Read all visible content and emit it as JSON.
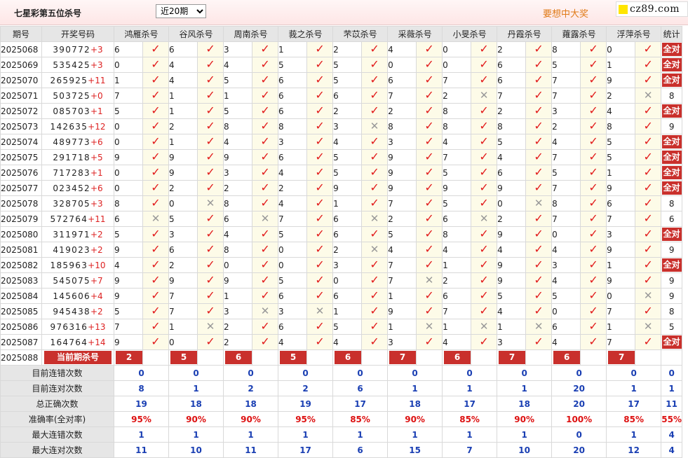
{
  "header": {
    "title": "七星彩第五位杀号",
    "period_selected": "近20期",
    "slogan": "要想中大奖",
    "logo_text": "cz89.com"
  },
  "columns": {
    "issue": "期号",
    "draw": "开奖号码",
    "experts": [
      "鸿雁杀号",
      "谷风杀号",
      "周南杀号",
      "莪之杀号",
      "芣苡杀号",
      "采薇杀号",
      "小旻杀号",
      "丹霞杀号",
      "蕹露杀号",
      "浮萍杀号"
    ],
    "stat": "统计"
  },
  "rows": [
    {
      "issue": "2025068",
      "digits": "390772",
      "plus": "+3",
      "picks": [
        [
          6,
          1
        ],
        [
          6,
          1
        ],
        [
          3,
          1
        ],
        [
          1,
          1
        ],
        [
          2,
          1
        ],
        [
          4,
          1
        ],
        [
          0,
          1
        ],
        [
          2,
          1
        ],
        [
          8,
          1
        ],
        [
          0,
          1
        ]
      ],
      "stat": "全对"
    },
    {
      "issue": "2025069",
      "digits": "535425",
      "plus": "+3",
      "picks": [
        [
          0,
          1
        ],
        [
          4,
          1
        ],
        [
          4,
          1
        ],
        [
          5,
          1
        ],
        [
          5,
          1
        ],
        [
          0,
          1
        ],
        [
          0,
          1
        ],
        [
          6,
          1
        ],
        [
          5,
          1
        ],
        [
          1,
          1
        ]
      ],
      "stat": "全对"
    },
    {
      "issue": "2025070",
      "digits": "265925",
      "plus": "+11",
      "picks": [
        [
          1,
          1
        ],
        [
          4,
          1
        ],
        [
          5,
          1
        ],
        [
          6,
          1
        ],
        [
          5,
          1
        ],
        [
          6,
          1
        ],
        [
          7,
          1
        ],
        [
          6,
          1
        ],
        [
          7,
          1
        ],
        [
          9,
          1
        ]
      ],
      "stat": "全对"
    },
    {
      "issue": "2025071",
      "digits": "503725",
      "plus": "+0",
      "picks": [
        [
          7,
          1
        ],
        [
          1,
          1
        ],
        [
          1,
          1
        ],
        [
          6,
          1
        ],
        [
          6,
          1
        ],
        [
          7,
          1
        ],
        [
          2,
          0
        ],
        [
          7,
          1
        ],
        [
          7,
          1
        ],
        [
          2,
          0
        ]
      ],
      "stat": "8"
    },
    {
      "issue": "2025072",
      "digits": "085703",
      "plus": "+1",
      "picks": [
        [
          5,
          1
        ],
        [
          1,
          1
        ],
        [
          5,
          1
        ],
        [
          6,
          1
        ],
        [
          2,
          1
        ],
        [
          2,
          1
        ],
        [
          8,
          1
        ],
        [
          2,
          1
        ],
        [
          3,
          1
        ],
        [
          4,
          1
        ]
      ],
      "stat": "全对"
    },
    {
      "issue": "2025073",
      "digits": "142635",
      "plus": "+12",
      "picks": [
        [
          0,
          1
        ],
        [
          2,
          1
        ],
        [
          8,
          1
        ],
        [
          8,
          1
        ],
        [
          3,
          0
        ],
        [
          8,
          1
        ],
        [
          8,
          1
        ],
        [
          8,
          1
        ],
        [
          2,
          1
        ],
        [
          8,
          1
        ]
      ],
      "stat": "9"
    },
    {
      "issue": "2025074",
      "digits": "489773",
      "plus": "+6",
      "picks": [
        [
          0,
          1
        ],
        [
          1,
          1
        ],
        [
          4,
          1
        ],
        [
          3,
          1
        ],
        [
          4,
          1
        ],
        [
          3,
          1
        ],
        [
          4,
          1
        ],
        [
          5,
          1
        ],
        [
          4,
          1
        ],
        [
          5,
          1
        ]
      ],
      "stat": "全对"
    },
    {
      "issue": "2025075",
      "digits": "291718",
      "plus": "+5",
      "picks": [
        [
          9,
          1
        ],
        [
          9,
          1
        ],
        [
          9,
          1
        ],
        [
          6,
          1
        ],
        [
          5,
          1
        ],
        [
          9,
          1
        ],
        [
          7,
          1
        ],
        [
          4,
          1
        ],
        [
          7,
          1
        ],
        [
          5,
          1
        ]
      ],
      "stat": "全对"
    },
    {
      "issue": "2025076",
      "digits": "717283",
      "plus": "+1",
      "picks": [
        [
          0,
          1
        ],
        [
          9,
          1
        ],
        [
          3,
          1
        ],
        [
          4,
          1
        ],
        [
          5,
          1
        ],
        [
          9,
          1
        ],
        [
          5,
          1
        ],
        [
          6,
          1
        ],
        [
          5,
          1
        ],
        [
          1,
          1
        ]
      ],
      "stat": "全对"
    },
    {
      "issue": "2025077",
      "digits": "023452",
      "plus": "+6",
      "picks": [
        [
          0,
          1
        ],
        [
          2,
          1
        ],
        [
          2,
          1
        ],
        [
          2,
          1
        ],
        [
          9,
          1
        ],
        [
          9,
          1
        ],
        [
          9,
          1
        ],
        [
          9,
          1
        ],
        [
          7,
          1
        ],
        [
          9,
          1
        ]
      ],
      "stat": "全对"
    },
    {
      "issue": "2025078",
      "digits": "328705",
      "plus": "+3",
      "picks": [
        [
          8,
          1
        ],
        [
          0,
          0
        ],
        [
          8,
          1
        ],
        [
          4,
          1
        ],
        [
          1,
          1
        ],
        [
          7,
          1
        ],
        [
          5,
          1
        ],
        [
          0,
          0
        ],
        [
          8,
          1
        ],
        [
          6,
          1
        ]
      ],
      "stat": "8"
    },
    {
      "issue": "2025079",
      "digits": "572764",
      "plus": "+11",
      "picks": [
        [
          6,
          0
        ],
        [
          5,
          1
        ],
        [
          6,
          0
        ],
        [
          7,
          1
        ],
        [
          6,
          0
        ],
        [
          2,
          1
        ],
        [
          6,
          0
        ],
        [
          2,
          1
        ],
        [
          7,
          1
        ],
        [
          7,
          1
        ]
      ],
      "stat": "6"
    },
    {
      "issue": "2025080",
      "digits": "311971",
      "plus": "+2",
      "picks": [
        [
          5,
          1
        ],
        [
          3,
          1
        ],
        [
          4,
          1
        ],
        [
          5,
          1
        ],
        [
          6,
          1
        ],
        [
          5,
          1
        ],
        [
          8,
          1
        ],
        [
          9,
          1
        ],
        [
          0,
          1
        ],
        [
          3,
          1
        ]
      ],
      "stat": "全对"
    },
    {
      "issue": "2025081",
      "digits": "419023",
      "plus": "+2",
      "picks": [
        [
          9,
          1
        ],
        [
          6,
          1
        ],
        [
          8,
          1
        ],
        [
          0,
          1
        ],
        [
          2,
          0
        ],
        [
          4,
          1
        ],
        [
          4,
          1
        ],
        [
          4,
          1
        ],
        [
          4,
          1
        ],
        [
          9,
          1
        ]
      ],
      "stat": "9"
    },
    {
      "issue": "2025082",
      "digits": "185963",
      "plus": "+10",
      "picks": [
        [
          4,
          1
        ],
        [
          2,
          1
        ],
        [
          0,
          1
        ],
        [
          0,
          1
        ],
        [
          3,
          1
        ],
        [
          7,
          1
        ],
        [
          1,
          1
        ],
        [
          9,
          1
        ],
        [
          3,
          1
        ],
        [
          1,
          1
        ]
      ],
      "stat": "全对"
    },
    {
      "issue": "2025083",
      "digits": "545075",
      "plus": "+7",
      "picks": [
        [
          9,
          1
        ],
        [
          9,
          1
        ],
        [
          9,
          1
        ],
        [
          5,
          1
        ],
        [
          0,
          1
        ],
        [
          7,
          0
        ],
        [
          2,
          1
        ],
        [
          9,
          1
        ],
        [
          4,
          1
        ],
        [
          9,
          1
        ]
      ],
      "stat": "9"
    },
    {
      "issue": "2025084",
      "digits": "145606",
      "plus": "+4",
      "picks": [
        [
          9,
          1
        ],
        [
          7,
          1
        ],
        [
          1,
          1
        ],
        [
          6,
          1
        ],
        [
          6,
          1
        ],
        [
          1,
          1
        ],
        [
          6,
          1
        ],
        [
          5,
          1
        ],
        [
          5,
          1
        ],
        [
          0,
          0
        ]
      ],
      "stat": "9"
    },
    {
      "issue": "2025085",
      "digits": "945438",
      "plus": "+2",
      "picks": [
        [
          5,
          1
        ],
        [
          7,
          1
        ],
        [
          3,
          0
        ],
        [
          3,
          0
        ],
        [
          1,
          1
        ],
        [
          9,
          1
        ],
        [
          7,
          1
        ],
        [
          4,
          1
        ],
        [
          0,
          1
        ],
        [
          7,
          1
        ]
      ],
      "stat": "8"
    },
    {
      "issue": "2025086",
      "digits": "976316",
      "plus": "+13",
      "picks": [
        [
          7,
          1
        ],
        [
          1,
          0
        ],
        [
          2,
          1
        ],
        [
          6,
          1
        ],
        [
          5,
          1
        ],
        [
          1,
          0
        ],
        [
          1,
          0
        ],
        [
          1,
          0
        ],
        [
          6,
          1
        ],
        [
          1,
          0
        ]
      ],
      "stat": "5"
    },
    {
      "issue": "2025087",
      "digits": "164764",
      "plus": "+14",
      "picks": [
        [
          9,
          1
        ],
        [
          0,
          1
        ],
        [
          2,
          1
        ],
        [
          4,
          1
        ],
        [
          4,
          1
        ],
        [
          3,
          1
        ],
        [
          4,
          1
        ],
        [
          3,
          1
        ],
        [
          4,
          1
        ],
        [
          7,
          1
        ]
      ],
      "stat": "全对"
    }
  ],
  "current": {
    "issue": "2025088",
    "label": "当前期杀号",
    "picks": [
      "2",
      "5",
      "6",
      "5",
      "6",
      "7",
      "6",
      "7",
      "6",
      "7"
    ]
  },
  "summary": [
    {
      "label": "目前连错次数",
      "values": [
        "0",
        "0",
        "0",
        "0",
        "0",
        "0",
        "0",
        "0",
        "0",
        "0"
      ],
      "stat": "0",
      "type": "n"
    },
    {
      "label": "目前连对次数",
      "values": [
        "8",
        "1",
        "2",
        "2",
        "6",
        "1",
        "1",
        "1",
        "20",
        "1"
      ],
      "stat": "1",
      "type": "n"
    },
    {
      "label": "总正确次数",
      "values": [
        "19",
        "18",
        "18",
        "19",
        "17",
        "18",
        "17",
        "18",
        "20",
        "17"
      ],
      "stat": "11",
      "type": "n"
    },
    {
      "label": "准确率(全对率)",
      "values": [
        "95%",
        "90%",
        "90%",
        "95%",
        "85%",
        "90%",
        "85%",
        "90%",
        "100%",
        "85%"
      ],
      "stat": "55%",
      "type": "r"
    },
    {
      "label": "最大连错次数",
      "values": [
        "1",
        "1",
        "1",
        "1",
        "1",
        "1",
        "1",
        "1",
        "0",
        "1"
      ],
      "stat": "4",
      "type": "n"
    },
    {
      "label": "最大连对次数",
      "values": [
        "11",
        "10",
        "11",
        "17",
        "6",
        "15",
        "7",
        "10",
        "20",
        "12"
      ],
      "stat": "4",
      "type": "n"
    }
  ],
  "colors": {
    "accent_red": "#c9302c",
    "check_red": "#e21b1b",
    "blue_value": "#1a3fb3",
    "slogan_orange": "#e07a17"
  },
  "icons": {
    "ok": "check-icon",
    "bad": "cross-icon"
  }
}
